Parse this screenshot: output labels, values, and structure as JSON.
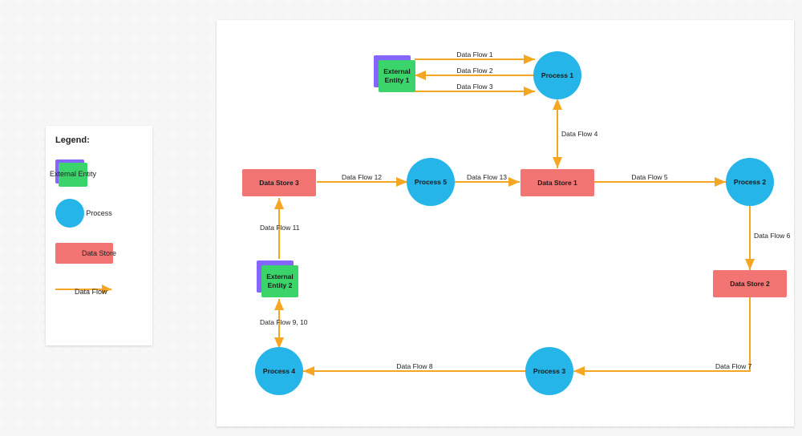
{
  "legend": {
    "title": "Legend:",
    "entity": "External Entity",
    "process": "Process",
    "store": "Data Store",
    "flow": "Data Flow"
  },
  "nodes": {
    "entity1": {
      "line1": "External",
      "line2": "Entity 1"
    },
    "entity2": {
      "line1": "External",
      "line2": "Entity 2"
    },
    "process1": "Process 1",
    "process2": "Process 2",
    "process3": "Process 3",
    "process4": "Process 4",
    "process5": "Process 5",
    "store1": "Data Store 1",
    "store2": "Data Store 2",
    "store3": "Data Store 3"
  },
  "flows": {
    "f1": "Data Flow 1",
    "f2": "Data Flow 2",
    "f3": "Data Flow 3",
    "f4": "Data Flow 4",
    "f5": "Data Flow 5",
    "f6": "Data Flow 6",
    "f7": "Data Flow 7",
    "f8": "Data Flow 8",
    "f9_10": "Data Flow 9, 10",
    "f11": "Data Flow 11",
    "f12": "Data Flow 12",
    "f13": "Data Flow 13"
  },
  "chart_data": {
    "type": "diagram",
    "title": "Data Flow Diagram",
    "node_types": [
      "external_entity",
      "process",
      "data_store"
    ],
    "nodes": [
      {
        "id": "E1",
        "type": "external_entity",
        "label": "External Entity 1"
      },
      {
        "id": "E2",
        "type": "external_entity",
        "label": "External Entity 2"
      },
      {
        "id": "P1",
        "type": "process",
        "label": "Process 1"
      },
      {
        "id": "P2",
        "type": "process",
        "label": "Process 2"
      },
      {
        "id": "P3",
        "type": "process",
        "label": "Process 3"
      },
      {
        "id": "P4",
        "type": "process",
        "label": "Process 4"
      },
      {
        "id": "P5",
        "type": "process",
        "label": "Process 5"
      },
      {
        "id": "D1",
        "type": "data_store",
        "label": "Data Store 1"
      },
      {
        "id": "D2",
        "type": "data_store",
        "label": "Data Store 2"
      },
      {
        "id": "D3",
        "type": "data_store",
        "label": "Data Store 3"
      }
    ],
    "edges": [
      {
        "label": "Data Flow 1",
        "from": "E1",
        "to": "P1",
        "bidirectional": false
      },
      {
        "label": "Data Flow 2",
        "from": "P1",
        "to": "E1",
        "bidirectional": false
      },
      {
        "label": "Data Flow 3",
        "from": "E1",
        "to": "P1",
        "bidirectional": false
      },
      {
        "label": "Data Flow 4",
        "from": "P1",
        "to": "D1",
        "bidirectional": true
      },
      {
        "label": "Data Flow 5",
        "from": "D1",
        "to": "P2",
        "bidirectional": false
      },
      {
        "label": "Data Flow 6",
        "from": "P2",
        "to": "D2",
        "bidirectional": false
      },
      {
        "label": "Data Flow 7",
        "from": "D2",
        "to": "P3",
        "bidirectional": false
      },
      {
        "label": "Data Flow 8",
        "from": "P3",
        "to": "P4",
        "bidirectional": false
      },
      {
        "label": "Data Flow 9, 10",
        "from": "P4",
        "to": "E2",
        "bidirectional": true
      },
      {
        "label": "Data Flow 11",
        "from": "E2",
        "to": "D3",
        "bidirectional": false
      },
      {
        "label": "Data Flow 12",
        "from": "D3",
        "to": "P5",
        "bidirectional": false
      },
      {
        "label": "Data Flow 13",
        "from": "P5",
        "to": "D1",
        "bidirectional": false
      }
    ]
  }
}
